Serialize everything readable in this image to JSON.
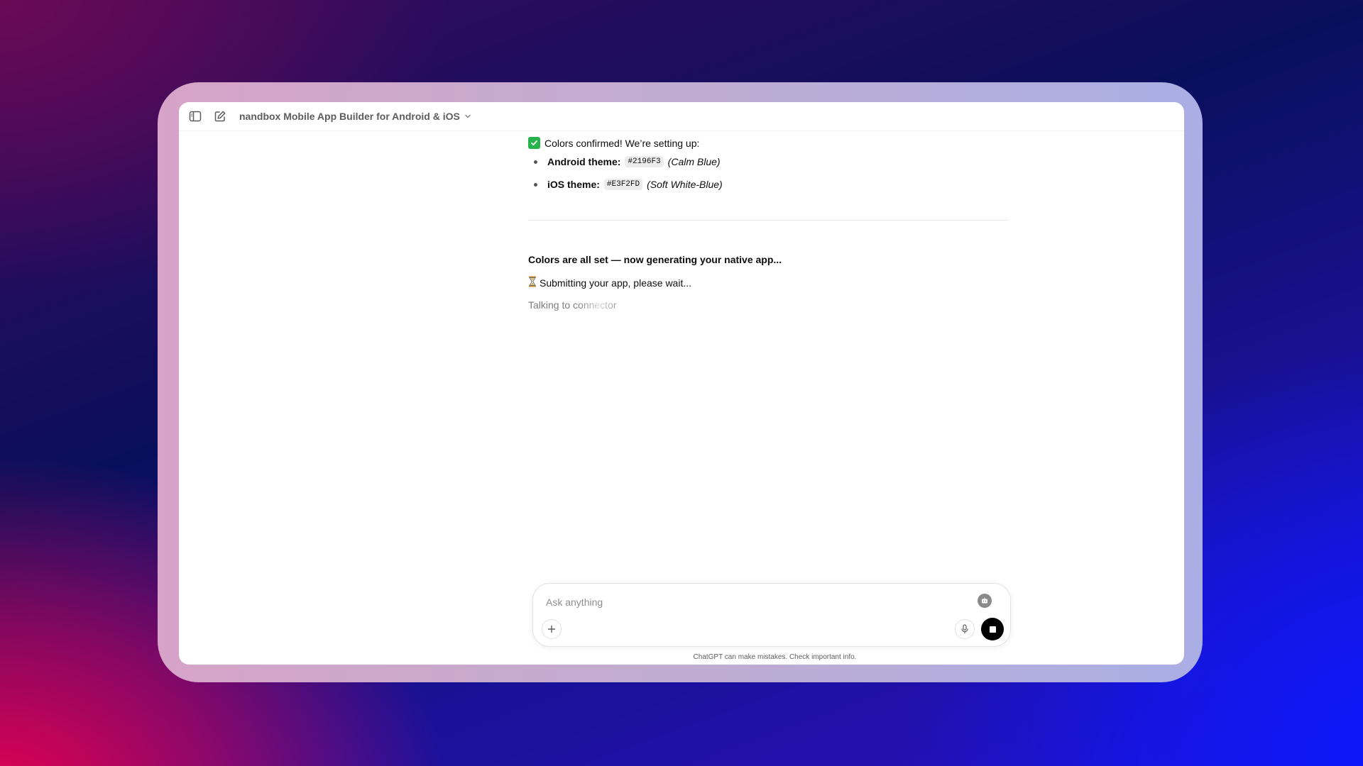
{
  "header": {
    "title": "nandbox Mobile App Builder for Android & iOS"
  },
  "messages": {
    "confirm_text": "Colors confirmed! We’re setting up:",
    "bullets": [
      {
        "label": "Android theme:",
        "code": "#2196F3",
        "note": "(Calm Blue)"
      },
      {
        "label": "iOS theme:",
        "code": "#E3F2FD",
        "note": "(Soft White-Blue)"
      }
    ],
    "status_bold": "Colors are all set — now generating your native app...",
    "submitting": "Submitting your app, please wait...",
    "talking": "Talking to connector"
  },
  "composer": {
    "placeholder": "Ask anything"
  },
  "footer": {
    "disclaimer": "ChatGPT can make mistakes. Check important info."
  },
  "icons": {
    "sidebar": "sidebar-toggle-icon",
    "edit": "new-chat-icon",
    "chevron": "chevron-down-icon",
    "check": "check-mark-icon",
    "hourglass": "hourglass-icon",
    "robot": "connector-icon",
    "plus": "plus-icon",
    "mic": "microphone-icon",
    "stop": "stop-icon"
  },
  "colors": {
    "check_green": "#27b34b",
    "stop_button": "#000000"
  }
}
